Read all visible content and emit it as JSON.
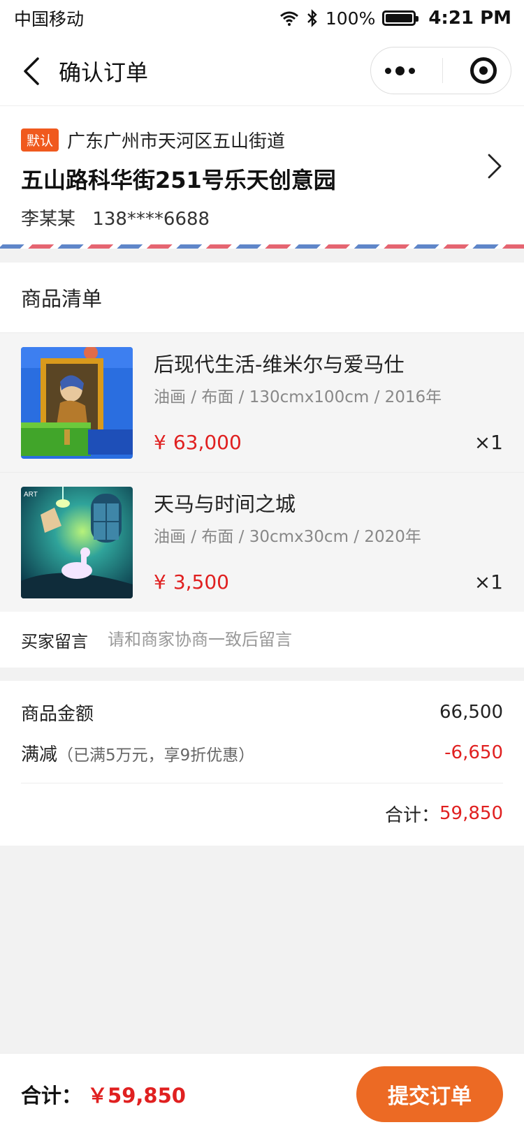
{
  "status_bar": {
    "carrier": "中国移动",
    "battery": "100%",
    "time": "4:21 PM"
  },
  "nav": {
    "title": "确认订单"
  },
  "address": {
    "badge": "默认",
    "region": "广东广州市天河区五山街道",
    "detail": "五山路科华街251号乐天创意园",
    "name": "李某某",
    "phone": "138****6688"
  },
  "goods": {
    "header": "商品清单",
    "items": [
      {
        "title": "后现代生活-维米尔与爱马仕",
        "spec": "油画 / 布面 / 130cmx100cm / 2016年",
        "currency": "¥",
        "price": "63,000",
        "qty": "×1"
      },
      {
        "title": "天马与时间之城",
        "spec": "油画 / 布面 / 30cmx30cm / 2020年",
        "currency": "¥",
        "price": "3,500",
        "qty": "×1"
      }
    ]
  },
  "message": {
    "label": "买家留言",
    "placeholder": "请和商家协商一致后留言"
  },
  "amount": {
    "goods_label": "商品金额",
    "goods_value": "66,500",
    "discount_label": "满减",
    "discount_note": "（已满5万元，享9折优惠）",
    "discount_value": "-6,650",
    "total_label": "合计：",
    "total_value": "59,850"
  },
  "bottom": {
    "total_label": "合计：",
    "total_value": "￥59,850",
    "submit_label": "提交订单"
  },
  "colors": {
    "accent": "#ec6a24",
    "price_red": "#e02020",
    "badge": "#f0591e",
    "airmail_red": "#e56571",
    "airmail_blue": "#5f86c9"
  }
}
